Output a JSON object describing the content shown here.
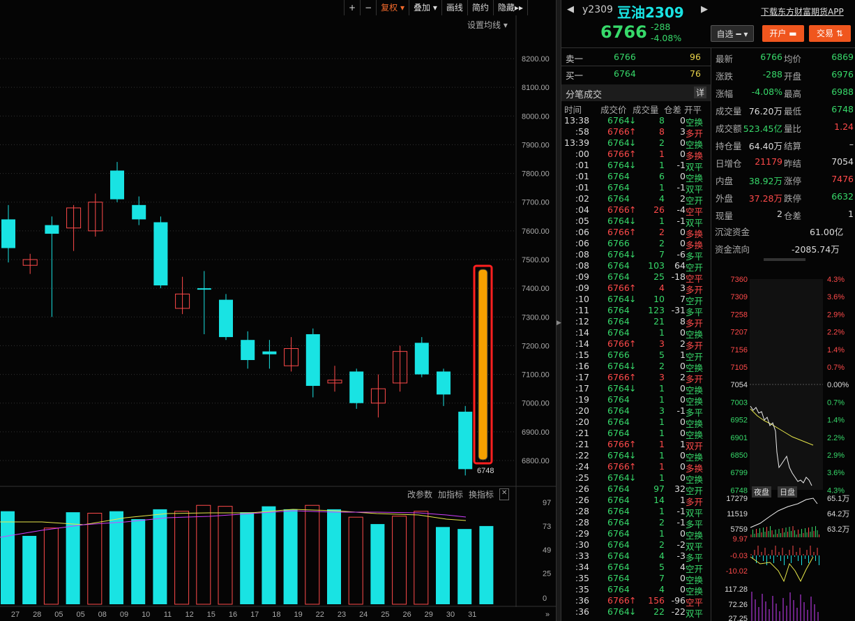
{
  "toolbar": {
    "plus": "+",
    "minus": "−",
    "fuquan": "复权",
    "diejia": "叠加",
    "huaxian": "画线",
    "jianyue": "简约",
    "yincang": "隐藏",
    "more": "▸▸"
  },
  "settings_ma": "设置均线",
  "price_ticks": [
    "8200.00",
    "8100.00",
    "8000.00",
    "7900.00",
    "7800.00",
    "7700.00",
    "7600.00",
    "7500.00",
    "7400.00",
    "7300.00",
    "7200.00",
    "7100.00",
    "7000.00",
    "6900.00",
    "6800.00"
  ],
  "low_label": "6748",
  "indicator_menu": {
    "params": "改参数",
    "add": "加指标",
    "switch": "换指标",
    "close": "✕"
  },
  "vol_ticks": [
    "97",
    "73",
    "49",
    "25",
    "0"
  ],
  "date_labels": [
    "27",
    "28",
    "05",
    "05",
    "08",
    "09",
    "10",
    "11",
    "12",
    "15",
    "16",
    "17",
    "18",
    "19",
    "22",
    "23",
    "24",
    "25",
    "26",
    "29",
    "30",
    "31"
  ],
  "candles": [
    {
      "o": 7540,
      "c": 7640,
      "h": 7690,
      "l": 7490,
      "up": false
    },
    {
      "o": 7500,
      "c": 7480,
      "h": 7520,
      "l": 7450,
      "up": true
    },
    {
      "o": 7620,
      "c": 7590,
      "h": 7650,
      "l": 7300,
      "up": false
    },
    {
      "o": 7610,
      "c": 7680,
      "h": 7690,
      "l": 7530,
      "up": true
    },
    {
      "o": 7700,
      "c": 7600,
      "h": 7730,
      "l": 7580,
      "up": true
    },
    {
      "o": 7810,
      "c": 7710,
      "h": 7840,
      "l": 7700,
      "up": false
    },
    {
      "o": 7690,
      "c": 7640,
      "h": 7720,
      "l": 7620,
      "up": false
    },
    {
      "o": 7630,
      "c": 7410,
      "h": 7650,
      "l": 7400,
      "up": false
    },
    {
      "o": 7330,
      "c": 7380,
      "h": 7440,
      "l": 7310,
      "up": true
    },
    {
      "o": 7400,
      "c": 7400,
      "h": 7460,
      "l": 7240,
      "up": false
    },
    {
      "o": 7360,
      "c": 7230,
      "h": 7380,
      "l": 7220,
      "up": false
    },
    {
      "o": 7220,
      "c": 7150,
      "h": 7250,
      "l": 7120,
      "up": false
    },
    {
      "o": 7180,
      "c": 7170,
      "h": 7220,
      "l": 7120,
      "up": false
    },
    {
      "o": 7190,
      "c": 7130,
      "h": 7230,
      "l": 7110,
      "up": true
    },
    {
      "o": 7240,
      "c": 7060,
      "h": 7260,
      "l": 7020,
      "up": false
    },
    {
      "o": 7080,
      "c": 7070,
      "h": 7130,
      "l": 7040,
      "up": true
    },
    {
      "o": 7110,
      "c": 7000,
      "h": 7120,
      "l": 6980,
      "up": false
    },
    {
      "o": 7000,
      "c": 7050,
      "h": 7100,
      "l": 6950,
      "up": true
    },
    {
      "o": 7070,
      "c": 7180,
      "h": 7200,
      "l": 7040,
      "up": true
    },
    {
      "o": 7210,
      "c": 7100,
      "h": 7230,
      "l": 7090,
      "up": false
    },
    {
      "o": 7110,
      "c": 7030,
      "h": 7120,
      "l": 6990,
      "up": false
    },
    {
      "o": 6970,
      "c": 6770,
      "h": 6990,
      "l": 6748,
      "up": false
    }
  ],
  "volumes": [
    {
      "v": 88,
      "up": false
    },
    {
      "v": 63,
      "up": false
    },
    {
      "v": 71,
      "up": true
    },
    {
      "v": 87,
      "up": false
    },
    {
      "v": 86,
      "up": true
    },
    {
      "v": 88,
      "up": false
    },
    {
      "v": 80,
      "up": false
    },
    {
      "v": 90,
      "up": false
    },
    {
      "v": 88,
      "up": true
    },
    {
      "v": 94,
      "up": true
    },
    {
      "v": 93,
      "up": true
    },
    {
      "v": 87,
      "up": false
    },
    {
      "v": 93,
      "up": false
    },
    {
      "v": 90,
      "up": false
    },
    {
      "v": 94,
      "up": true
    },
    {
      "v": 90,
      "up": false
    },
    {
      "v": 82,
      "up": true
    },
    {
      "v": 75,
      "up": false
    },
    {
      "v": 83,
      "up": true
    },
    {
      "v": 88,
      "up": true
    },
    {
      "v": 72,
      "up": false
    },
    {
      "v": 70,
      "up": false
    },
    {
      "v": 73,
      "up": false
    }
  ],
  "header": {
    "code": "y2309",
    "name": "豆油2309",
    "price": "6766",
    "change": "-288",
    "pct": "-4.08%",
    "download": "下载东方财富期货APP",
    "zixuan": "自选",
    "kaihu": "开户",
    "jiaoyi": "交易"
  },
  "orderbook": [
    {
      "label": "卖一",
      "price": "6766",
      "vol": "96"
    },
    {
      "label": "买一",
      "price": "6764",
      "vol": "76"
    }
  ],
  "trades_title": "分笔成交",
  "trades_detail": "详",
  "trades_header": [
    "时间",
    "成交价",
    "成交量",
    "仓差",
    "开平"
  ],
  "trades": [
    [
      "13:38",
      "6764",
      "↓",
      "8",
      "0",
      "空换"
    ],
    [
      ":58",
      "6766",
      "↑",
      "8",
      "3",
      "多开"
    ],
    [
      "13:39",
      "6764",
      "↓",
      "2",
      "0",
      "空换"
    ],
    [
      ":00",
      "6766",
      "↑",
      "1",
      "0",
      "多换"
    ],
    [
      ":01",
      "6764",
      "↓",
      "1",
      "-1",
      "双平"
    ],
    [
      ":01",
      "6764",
      "",
      "6",
      "0",
      "空换"
    ],
    [
      ":01",
      "6764",
      "",
      "1",
      "-1",
      "双平"
    ],
    [
      ":02",
      "6764",
      "",
      "4",
      "2",
      "空开"
    ],
    [
      ":04",
      "6766",
      "↑",
      "26",
      "-4",
      "空平"
    ],
    [
      ":05",
      "6764",
      "↓",
      "1",
      "-1",
      "双平"
    ],
    [
      ":06",
      "6766",
      "↑",
      "2",
      "0",
      "多换"
    ],
    [
      ":06",
      "6766",
      "",
      "2",
      "0",
      "多换"
    ],
    [
      ":08",
      "6764",
      "↓",
      "7",
      "-6",
      "多平"
    ],
    [
      ":08",
      "6764",
      "",
      "103",
      "64",
      "空开"
    ],
    [
      ":09",
      "6764",
      "",
      "25",
      "-18",
      "空平"
    ],
    [
      ":09",
      "6766",
      "↑",
      "4",
      "3",
      "多开"
    ],
    [
      ":10",
      "6764",
      "↓",
      "10",
      "7",
      "空开"
    ],
    [
      ":11",
      "6764",
      "",
      "123",
      "-31",
      "多平"
    ],
    [
      ":12",
      "6764",
      "",
      "21",
      "8",
      "多开"
    ],
    [
      ":14",
      "6764",
      "",
      "1",
      "0",
      "空换"
    ],
    [
      ":14",
      "6766",
      "↑",
      "3",
      "2",
      "多开"
    ],
    [
      ":15",
      "6766",
      "",
      "5",
      "1",
      "空开"
    ],
    [
      ":16",
      "6764",
      "↓",
      "2",
      "0",
      "空换"
    ],
    [
      ":17",
      "6766",
      "↑",
      "3",
      "2",
      "多开"
    ],
    [
      ":17",
      "6764",
      "↓",
      "1",
      "0",
      "空换"
    ],
    [
      ":19",
      "6764",
      "",
      "1",
      "0",
      "空换"
    ],
    [
      ":20",
      "6764",
      "",
      "3",
      "-1",
      "多平"
    ],
    [
      ":20",
      "6764",
      "",
      "1",
      "0",
      "空换"
    ],
    [
      ":21",
      "6764",
      "",
      "1",
      "0",
      "空换"
    ],
    [
      ":21",
      "6766",
      "↑",
      "1",
      "1",
      "双开"
    ],
    [
      ":22",
      "6764",
      "↓",
      "1",
      "0",
      "空换"
    ],
    [
      ":24",
      "6766",
      "↑",
      "1",
      "0",
      "多换"
    ],
    [
      ":25",
      "6764",
      "↓",
      "1",
      "0",
      "空换"
    ],
    [
      ":26",
      "6764",
      "",
      "97",
      "32",
      "空开"
    ],
    [
      ":26",
      "6764",
      "",
      "14",
      "1",
      "多开"
    ],
    [
      ":28",
      "6764",
      "",
      "1",
      "-1",
      "双平"
    ],
    [
      ":28",
      "6764",
      "",
      "2",
      "-1",
      "多平"
    ],
    [
      ":29",
      "6764",
      "",
      "1",
      "0",
      "空换"
    ],
    [
      ":30",
      "6764",
      "",
      "2",
      "-2",
      "双平"
    ],
    [
      ":33",
      "6764",
      "",
      "4",
      "-3",
      "多平"
    ],
    [
      ":34",
      "6764",
      "",
      "5",
      "4",
      "空开"
    ],
    [
      ":35",
      "6764",
      "",
      "7",
      "0",
      "空换"
    ],
    [
      ":35",
      "6764",
      "",
      "4",
      "0",
      "空换"
    ],
    [
      ":36",
      "6766",
      "↑",
      "156",
      "-96",
      "空平"
    ],
    [
      ":36",
      "6764",
      "↓",
      "22",
      "-22",
      "双平"
    ]
  ],
  "quote": [
    [
      {
        "k": "最新",
        "v": "6766",
        "c": "g"
      },
      {
        "k": "均价",
        "v": "6869",
        "c": "g"
      }
    ],
    [
      {
        "k": "涨跌",
        "v": "-288",
        "c": "g"
      },
      {
        "k": "开盘",
        "v": "6976",
        "c": "g"
      }
    ],
    [
      {
        "k": "涨幅",
        "v": "-4.08%",
        "c": "g"
      },
      {
        "k": "最高",
        "v": "6988",
        "c": "g"
      }
    ],
    [
      {
        "k": "成交量",
        "v": "76.20万",
        "c": "w"
      },
      {
        "k": "最低",
        "v": "6748",
        "c": "g"
      }
    ],
    [
      {
        "k": "成交额",
        "v": "523.45亿",
        "c": "g"
      },
      {
        "k": "量比",
        "v": "1.24",
        "c": "r"
      }
    ],
    [
      {
        "k": "持仓量",
        "v": "64.40万",
        "c": "w"
      },
      {
        "k": "结算",
        "v": "–",
        "c": "w"
      }
    ],
    [
      {
        "k": "日增仓",
        "v": "21179",
        "c": "r"
      },
      {
        "k": "昨结",
        "v": "7054",
        "c": "w"
      }
    ],
    [
      {
        "k": "内盘",
        "v": "38.92万",
        "c": "g"
      },
      {
        "k": "涨停",
        "v": "7476",
        "c": "r"
      }
    ],
    [
      {
        "k": "外盘",
        "v": "37.28万",
        "c": "r"
      },
      {
        "k": "跌停",
        "v": "6632",
        "c": "g"
      }
    ],
    [
      {
        "k": "现量",
        "v": "2",
        "c": "w"
      },
      {
        "k": "仓差",
        "v": "1",
        "c": "w"
      }
    ]
  ],
  "chenglian": {
    "k": "沉淀资金",
    "v": "61.00亿"
  },
  "liuxiang": {
    "k": "资金流向",
    "v": "-2085.74万"
  },
  "mini_left": [
    "7360",
    "7309",
    "7258",
    "7207",
    "7156",
    "7105",
    "7054",
    "7003",
    "6952",
    "6901",
    "6850",
    "6799",
    "6748"
  ],
  "mini_right": [
    "4.3%",
    "3.6%",
    "2.9%",
    "2.2%",
    "1.4%",
    "0.7%",
    "0.00%",
    "0.7%",
    "1.4%",
    "2.2%",
    "2.9%",
    "3.6%",
    "4.3%"
  ],
  "mini_vol_left": [
    "17279",
    "11519",
    "5759"
  ],
  "mini_vol_right": [
    "65.1万",
    "64.2万",
    "63.2万"
  ],
  "mini_ind": [
    "9.97",
    "-0.03",
    "-10.02",
    "117.28",
    "72.26",
    "27.25"
  ],
  "night": "夜盘",
  "day": "日盘",
  "colors": {
    "up": "#ff4a4a",
    "down": "#19e3e3",
    "ma_yellow": "#e8e84a",
    "ma_purple": "#d040ff",
    "highlight": "#f5a000"
  }
}
